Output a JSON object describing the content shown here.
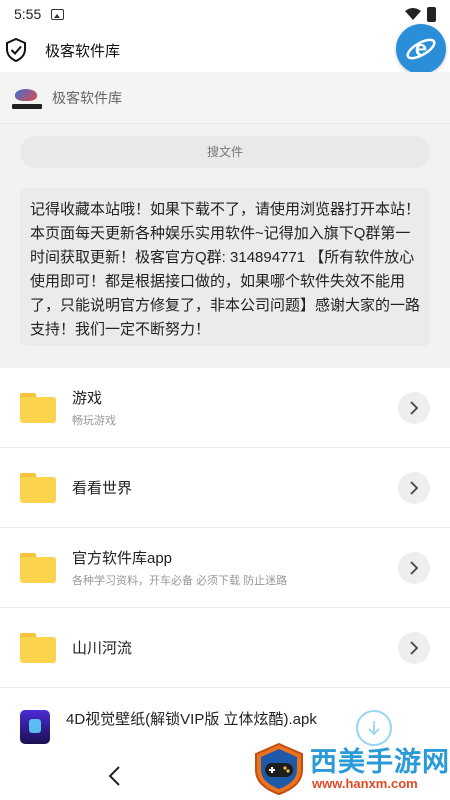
{
  "status_bar": {
    "time": "5:55"
  },
  "app_bar": {
    "title": "极客软件库",
    "browser_button_icon": "ie-icon"
  },
  "site": {
    "name": "极客软件库",
    "logo_text": "极客软件库"
  },
  "search": {
    "placeholder": "搜文件"
  },
  "notice": {
    "text": "记得收藏本站哦！如果下载不了，请使用浏览器打开本站！本页面每天更新各种娱乐实用软件~记得加入旗下Q群第一时间获取更新！极客官方Q群: 314894771 【所有软件放心使用即可！都是根据接口做的，如果哪个软件失效不能用了，只能说明官方修复了，非本公司问题】感谢大家的一路支持！我们一定不断努力！"
  },
  "list": {
    "folders": [
      {
        "name": "游戏",
        "subtitle": "畅玩游戏"
      },
      {
        "name": "看看世界",
        "subtitle": ""
      },
      {
        "name": "官方软件库app",
        "subtitle": "各种学习资料，开车必备 必须下载 防止迷路"
      },
      {
        "name": "山川河流",
        "subtitle": ""
      }
    ],
    "file": {
      "name": "4D视觉壁纸(解锁VIP版 立体炫酷).apk"
    }
  },
  "watermark": {
    "title": "西美手游网",
    "url": "www.hanxm.com"
  },
  "colors": {
    "accent": "#2a8fd8",
    "folder": "#fcd34d",
    "watermark_blue": "#2a9ad9",
    "watermark_red": "#e24a24"
  }
}
